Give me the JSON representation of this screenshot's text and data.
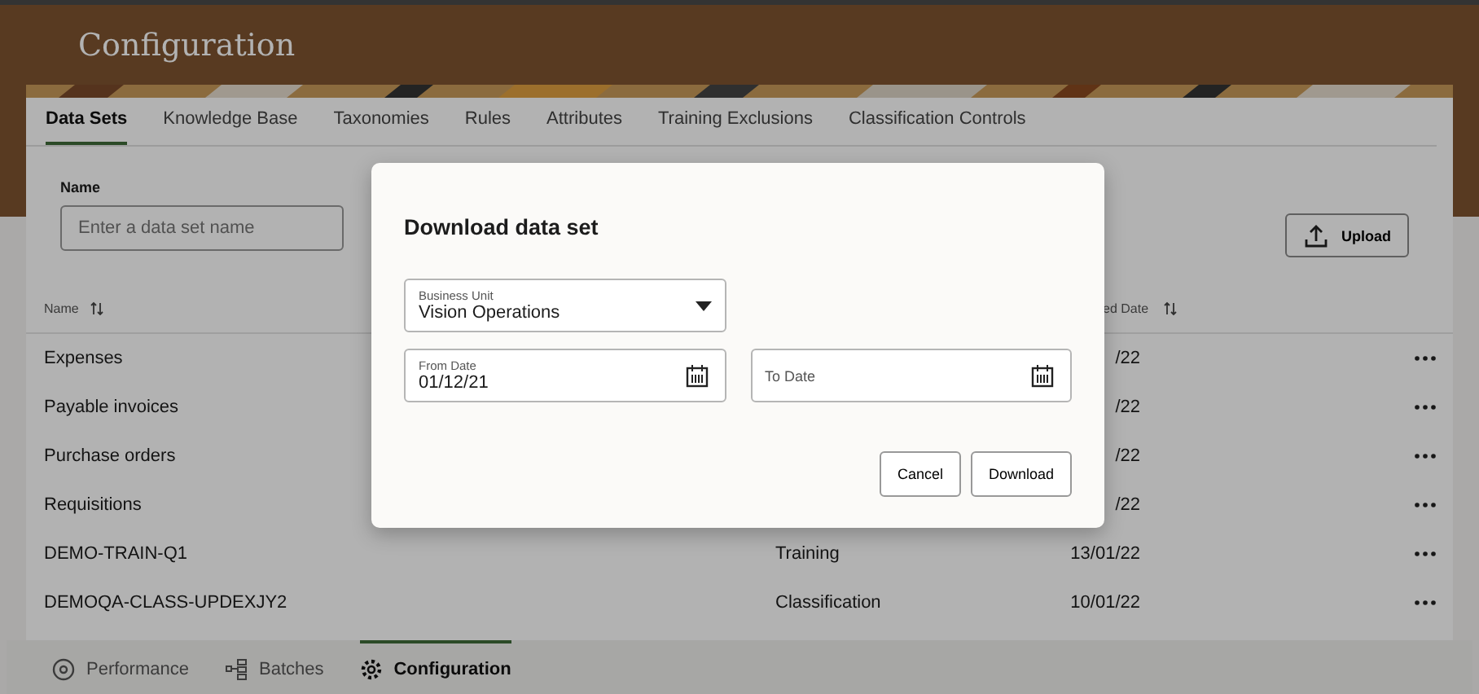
{
  "header": {
    "title": "Configuration"
  },
  "tabs": [
    {
      "label": "Data Sets",
      "selected": true
    },
    {
      "label": "Knowledge Base",
      "selected": false
    },
    {
      "label": "Taxonomies",
      "selected": false
    },
    {
      "label": "Rules",
      "selected": false
    },
    {
      "label": "Attributes",
      "selected": false
    },
    {
      "label": "Training Exclusions",
      "selected": false
    },
    {
      "label": "Classification Controls",
      "selected": false
    }
  ],
  "filter": {
    "label": "Name",
    "placeholder": "Enter a data set name"
  },
  "upload_button": "Upload",
  "table": {
    "columns": [
      {
        "label": "Name"
      },
      {
        "label": "ed Date"
      }
    ],
    "rows": [
      {
        "name": "Expenses",
        "date": "/22"
      },
      {
        "name": "Payable invoices",
        "date": "/22"
      },
      {
        "name": "Purchase orders",
        "date": "/22"
      },
      {
        "name": "Requisitions",
        "date": "/22"
      },
      {
        "name": "DEMO-TRAIN-Q1",
        "type": "Training",
        "date": "13/01/22"
      },
      {
        "name": "DEMOQA-CLASS-UPDEXJY2",
        "type": "Classification",
        "date": "10/01/22"
      }
    ]
  },
  "bottom_nav": [
    {
      "kind": "gauge",
      "label": "Performance",
      "selected": false
    },
    {
      "kind": "batches",
      "label": "Batches",
      "selected": false
    },
    {
      "kind": "gear",
      "label": "Configuration",
      "selected": true
    }
  ],
  "dialog": {
    "title": "Download data set",
    "business_unit": {
      "label": "Business Unit",
      "value": "Vision Operations"
    },
    "from_date": {
      "label": "From Date",
      "value": "01/12/21"
    },
    "to_date": {
      "placeholder": "To Date"
    },
    "buttons": [
      "Cancel",
      "Download"
    ]
  }
}
